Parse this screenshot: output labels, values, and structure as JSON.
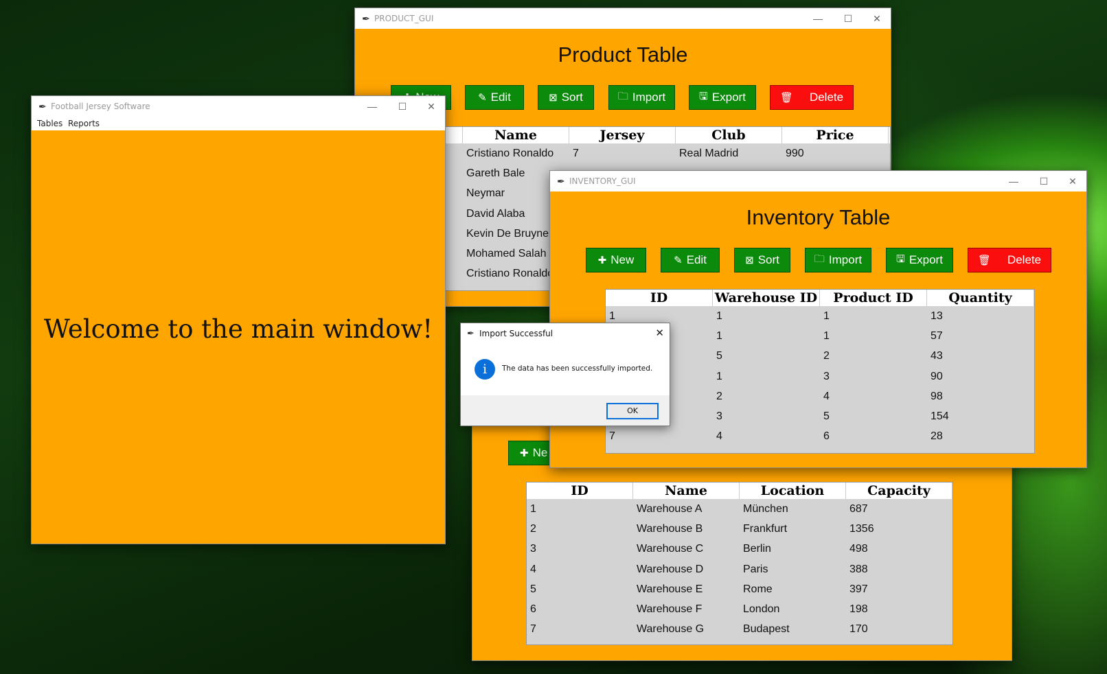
{
  "product_window": {
    "title": "PRODUCT_GUI",
    "heading": "Product Table",
    "buttons": {
      "new": "New",
      "edit": "Edit",
      "sort": "Sort",
      "import": "Import",
      "export": "Export",
      "delete": "Delete"
    },
    "columns": [
      "Name",
      "Jersey",
      "Club",
      "Price"
    ],
    "rows": [
      [
        "Cristiano Ronaldo",
        "7",
        "Real Madrid",
        "990"
      ],
      [
        "Gareth Bale",
        "",
        "",
        ""
      ],
      [
        "Neymar",
        "",
        "",
        ""
      ],
      [
        "David Alaba",
        "",
        "",
        ""
      ],
      [
        "Kevin De Bruyne",
        "",
        "",
        ""
      ],
      [
        "Mohamed Salah",
        "",
        "",
        ""
      ],
      [
        "Cristiano Ronaldo",
        "",
        "",
        ""
      ]
    ]
  },
  "main_window": {
    "title": "Football Jersey Software",
    "menu": [
      "Tables",
      "Reports"
    ],
    "welcome": "Welcome to the main window!"
  },
  "inventory_window": {
    "title": "INVENTORY_GUI",
    "heading": "Inventory Table",
    "buttons": {
      "new": "New",
      "edit": "Edit",
      "sort": "Sort",
      "import": "Import",
      "export": "Export",
      "delete": "Delete"
    },
    "columns": [
      "ID",
      "Warehouse ID",
      "Product ID",
      "Quantity"
    ],
    "rows": [
      [
        "1",
        "1",
        "1",
        "13"
      ],
      [
        "",
        "1",
        "1",
        "57"
      ],
      [
        "",
        "5",
        "2",
        "43"
      ],
      [
        "",
        "1",
        "3",
        "90"
      ],
      [
        "",
        "2",
        "4",
        "98"
      ],
      [
        "",
        "3",
        "5",
        "154"
      ],
      [
        "7",
        "4",
        "6",
        "28"
      ]
    ]
  },
  "warehouse_window": {
    "new_button": "Ne",
    "columns": [
      "ID",
      "Name",
      "Location",
      "Capacity"
    ],
    "rows": [
      [
        "1",
        "Warehouse A",
        "München",
        "687"
      ],
      [
        "2",
        "Warehouse B",
        "Frankfurt",
        "1356"
      ],
      [
        "3",
        "Warehouse C",
        "Berlin",
        "498"
      ],
      [
        "4",
        "Warehouse D",
        "Paris",
        "388"
      ],
      [
        "5",
        "Warehouse E",
        "Rome",
        "397"
      ],
      [
        "6",
        "Warehouse F",
        "London",
        "198"
      ],
      [
        "7",
        "Warehouse G",
        "Budapest",
        "170"
      ]
    ]
  },
  "dialog": {
    "title": "Import Successful",
    "message": "The data has been successfully imported.",
    "ok": "OK"
  },
  "icons": {
    "app": "feather-icon",
    "info": "info-icon"
  },
  "colors": {
    "window_bg": "#ffa500",
    "button_green": "#0b8a0b",
    "button_red": "#fa0e0e",
    "table_bg": "#d3d3d3",
    "info_blue": "#0a6fd8"
  }
}
